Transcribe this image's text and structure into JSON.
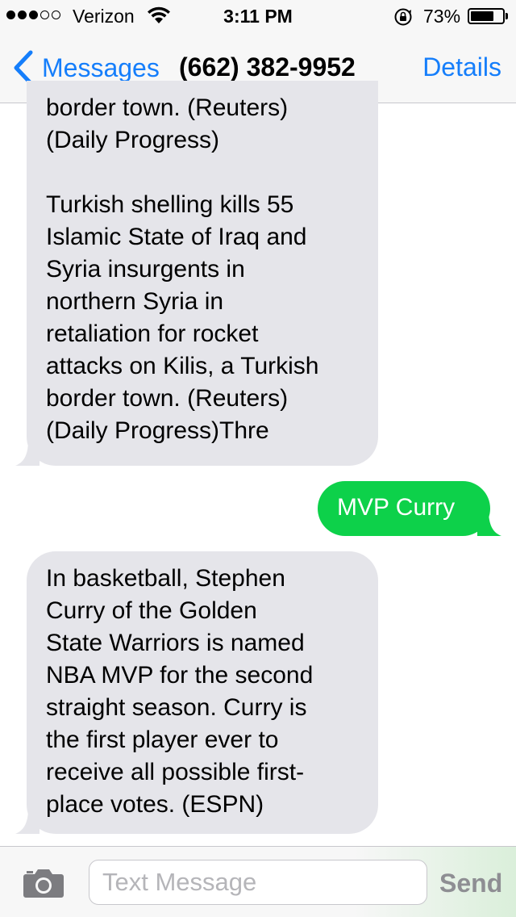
{
  "status_bar": {
    "carrier": "Verizon",
    "time": "3:11 PM",
    "battery_percent": "73%",
    "battery_level": 0.73,
    "signal_bars_filled": 3,
    "signal_bars_total": 5
  },
  "nav": {
    "back_label": "Messages",
    "title": "(662) 382-9952",
    "details_label": "Details"
  },
  "messages": [
    {
      "direction": "incoming",
      "text": "border town. (Reuters)\n(Daily Progress)\n\nTurkish shelling kills 55\nIslamic State of Iraq and\nSyria insurgents in\nnorthern Syria in\nretaliation for rocket\nattacks on Kilis, a Turkish\nborder town. (Reuters)\n(Daily Progress)Thre"
    },
    {
      "direction": "outgoing",
      "text": "MVP Curry"
    },
    {
      "direction": "incoming",
      "text": "In basketball, Stephen\nCurry of the Golden\nState Warriors is named\nNBA MVP for the second\nstraight season. Curry is\nthe first player ever to\nreceive all possible first-\nplace votes. (ESPN)"
    }
  ],
  "composer": {
    "placeholder": "Text Message",
    "value": "",
    "send_label": "Send"
  },
  "colors": {
    "accent": "#157efb",
    "incoming_bubble": "#e5e5ea",
    "outgoing_bubble": "#0dd14a",
    "send_disabled": "#8e8e93"
  }
}
